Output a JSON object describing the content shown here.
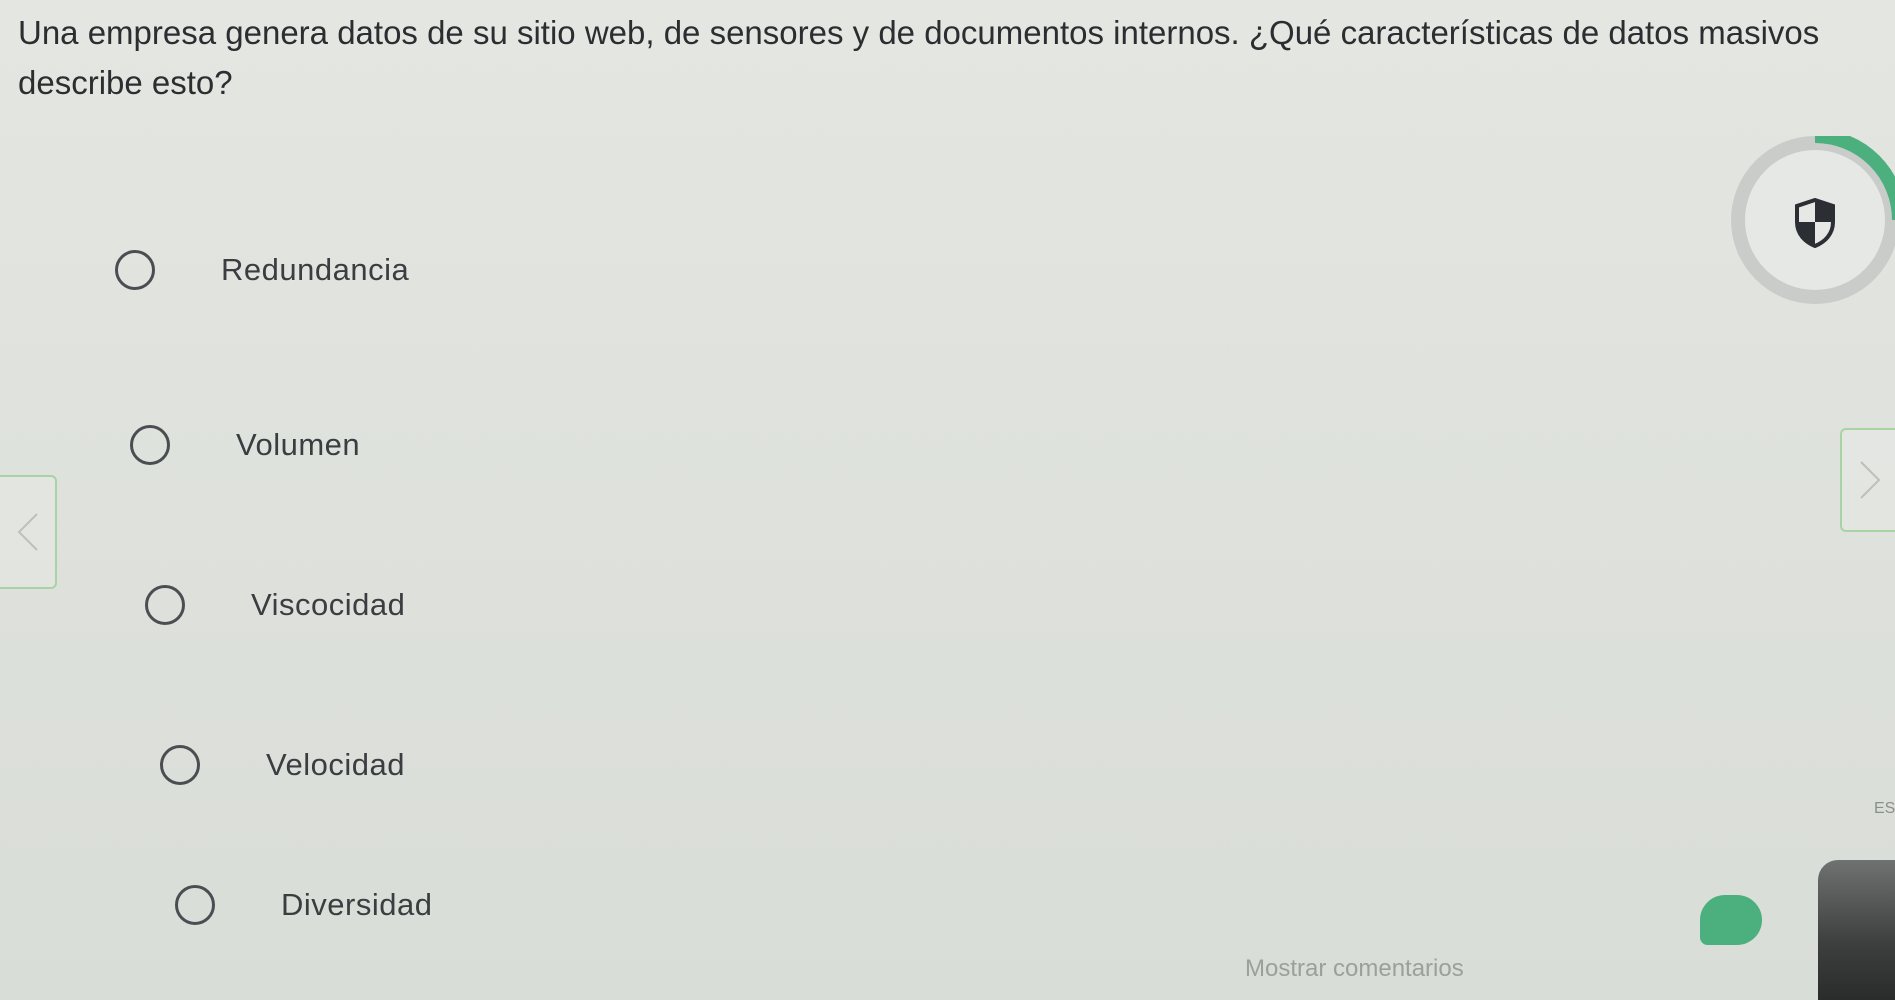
{
  "question": {
    "text": "Una empresa genera datos de su sitio web, de sensores y de documentos internos. ¿Qué características de datos masivos describe esto?"
  },
  "options": [
    {
      "label": "Redundancia",
      "selected": false
    },
    {
      "label": "Volumen",
      "selected": false
    },
    {
      "label": "Viscocidad",
      "selected": false
    },
    {
      "label": "Velocidad",
      "selected": false
    },
    {
      "label": "Diversidad",
      "selected": false
    }
  ],
  "footer": {
    "comments_label": "Mostrar comentarios"
  },
  "tray": {
    "language": "ES"
  },
  "icons": {
    "shield": "shield-icon",
    "prev": "chevron-left-icon",
    "next": "chevron-right-icon",
    "chat": "chat-bubble-icon"
  },
  "colors": {
    "accent_green": "#4bb07e",
    "nav_border": "#a8d3a2"
  }
}
